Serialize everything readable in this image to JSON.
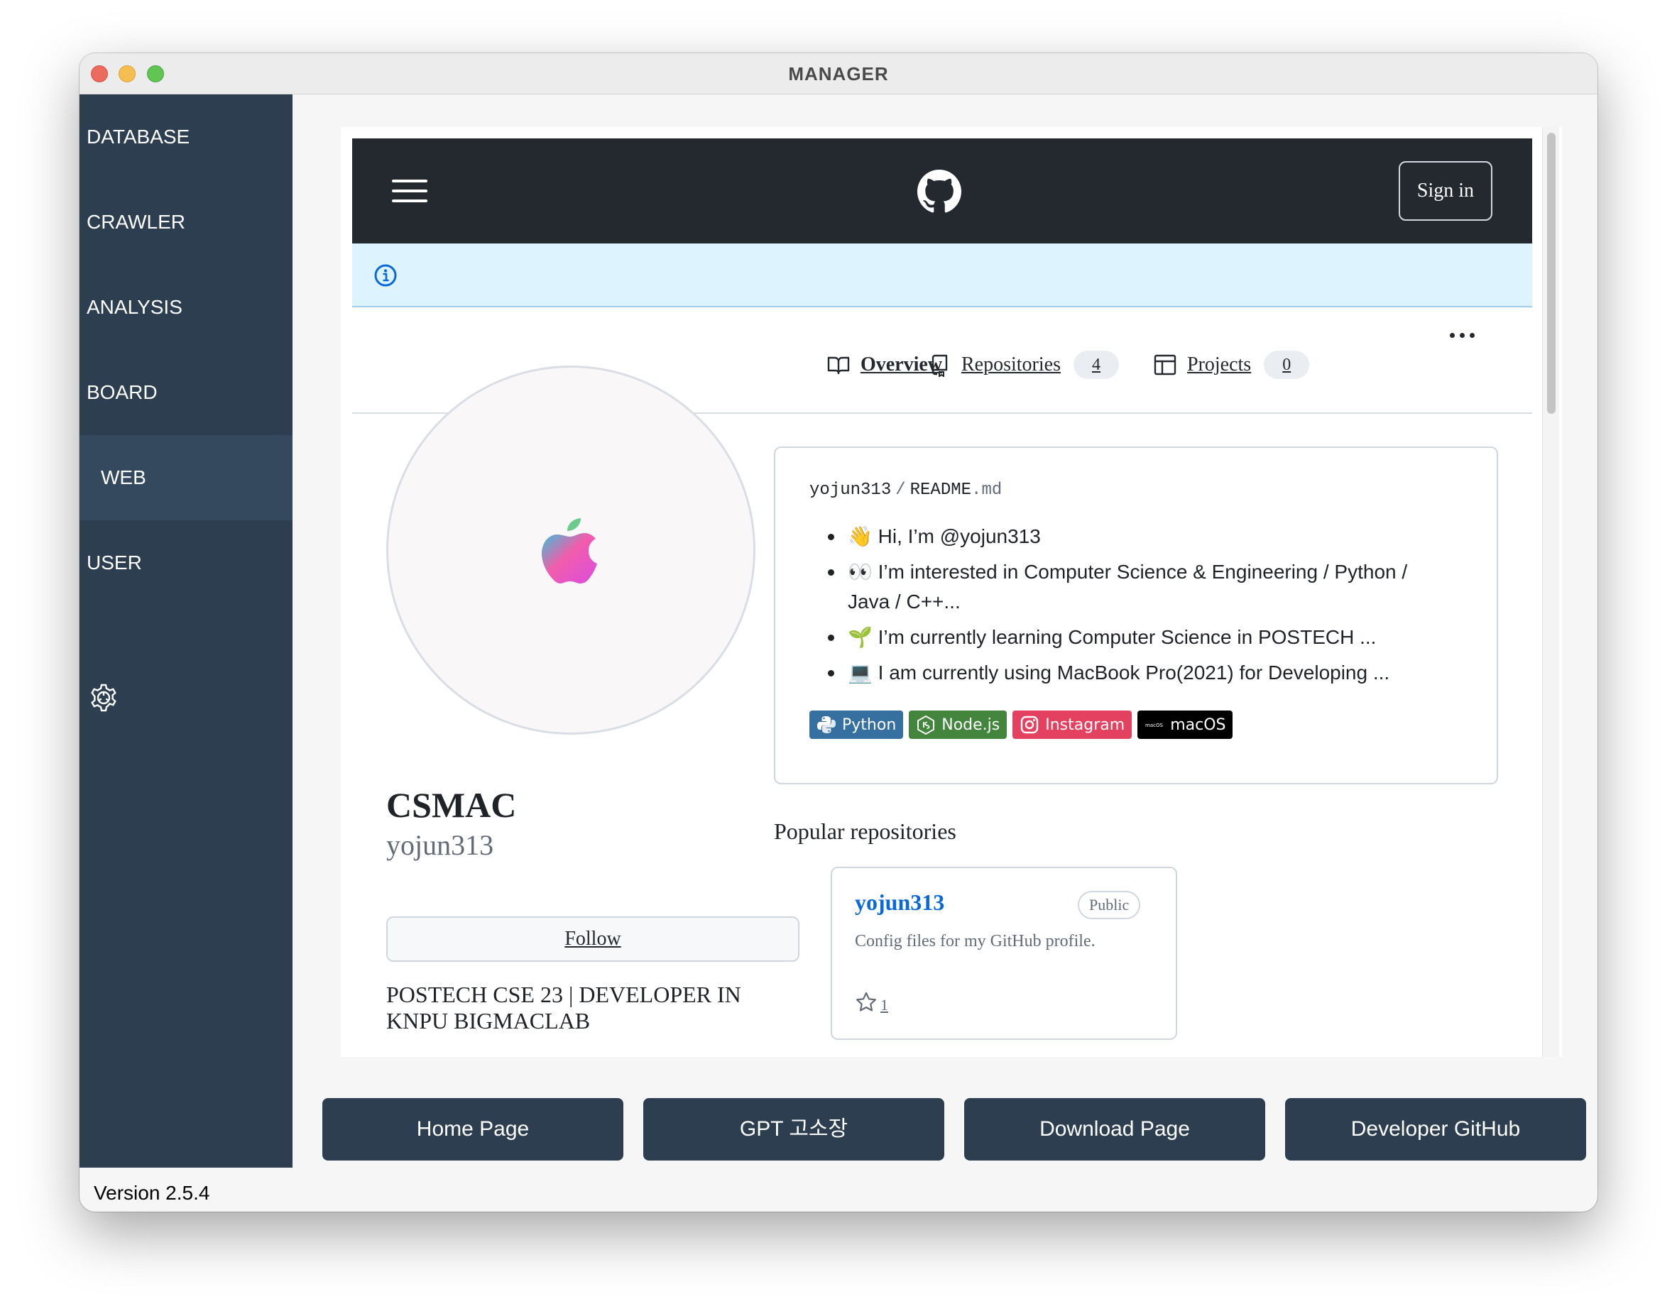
{
  "window": {
    "title": "MANAGER"
  },
  "sidebar": {
    "items": [
      {
        "label": "DATABASE"
      },
      {
        "label": "CRAWLER"
      },
      {
        "label": "ANALYSIS"
      },
      {
        "label": "BOARD"
      },
      {
        "label": "WEB",
        "active": true
      },
      {
        "label": "USER"
      }
    ],
    "settings_icon": "gear-icon",
    "version": "Version 2.5.4"
  },
  "github": {
    "header": {
      "menu_icon": "hamburger-icon",
      "logo_icon": "github-logo-icon",
      "signin_label": "Sign in"
    },
    "info_icon": "info-icon",
    "tabs": [
      {
        "label": "Overview",
        "icon": "book-icon",
        "selected": true
      },
      {
        "label": "Repositories",
        "icon": "repo-icon",
        "count": "4"
      },
      {
        "label": "Projects",
        "icon": "table-icon",
        "count": "0"
      }
    ],
    "more_icon": "kebab-horizontal-icon",
    "profile": {
      "avatar_icon": "apple-logo-icon",
      "name": "CSMAC",
      "login": "yojun313",
      "follow_label": "Follow",
      "bio": "POSTECH CSE 23 | DEVELOPER IN KNPU BIGMACLAB"
    },
    "readme": {
      "owner": "yojun313",
      "separator": "/",
      "file_base": "README",
      "file_ext": ".md",
      "items": [
        "👋 Hi, I’m @yojun313",
        "👀 I’m interested in Computer Science & Engineering / Python / Java / C++...",
        "🌱 I’m currently learning Computer Science in POSTECH ...",
        "💻 I am currently using MacBook Pro(2021) for Developing ..."
      ],
      "badges": [
        {
          "label": "Python",
          "color": "#3670a0",
          "icon": "python-icon"
        },
        {
          "label": "Node.js",
          "color": "#43853d",
          "icon": "nodejs-icon"
        },
        {
          "label": "Instagram",
          "color": "#e4405f",
          "icon": "instagram-icon"
        },
        {
          "label": "macOS",
          "color": "#000000",
          "icon": "macos-icon"
        }
      ]
    },
    "popular": {
      "title": "Popular repositories",
      "repos": [
        {
          "name": "yojun313",
          "visibility": "Public",
          "description": "Config files for my GitHub profile.",
          "stars": "1"
        }
      ]
    }
  },
  "bottom_buttons": [
    {
      "label": "Home Page"
    },
    {
      "label": "GPT 고소장"
    },
    {
      "label": "Download Page"
    },
    {
      "label": "Developer GitHub"
    }
  ],
  "colors": {
    "sidebar_bg": "#2c3e50",
    "sidebar_active": "#34495e",
    "github_header": "#24292f",
    "info_bar": "#ddf4ff",
    "link": "#0969da"
  }
}
